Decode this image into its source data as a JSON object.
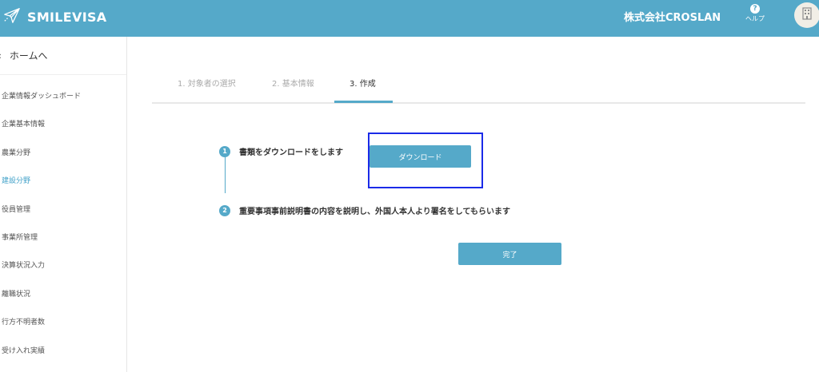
{
  "header": {
    "app_name": "SMILEVISA",
    "company_name": "株式会社CROSLAN",
    "help_label": "ヘルプ",
    "help_glyph": "?",
    "logo_icon": "paper-plane-icon",
    "avatar_icon": "building-icon",
    "bg_color": "#55a9c9"
  },
  "sidebar": {
    "home_label": "ホームへ",
    "home_chevron": "‹",
    "items": [
      {
        "label": "企業情報ダッシュボード"
      },
      {
        "label": "企業基本情報"
      },
      {
        "label": "農業分野"
      },
      {
        "label": "建設分野"
      },
      {
        "label": "役員管理"
      },
      {
        "label": "事業所管理"
      },
      {
        "label": "決算状況入力"
      },
      {
        "label": "離職状況"
      },
      {
        "label": "行方不明者数"
      },
      {
        "label": "受け入れ実績"
      }
    ],
    "active_item": "建設分野",
    "active_color": "#3fa0c8"
  },
  "stepper": {
    "steps": [
      {
        "label": "1. 対象者の選択"
      },
      {
        "label": "2. 基本情報"
      },
      {
        "label": "3. 作成"
      }
    ],
    "current_step": 3
  },
  "main": {
    "step1": {
      "number": "1",
      "text": "書類をダウンロードをします",
      "button_label": "ダウンロード"
    },
    "step2": {
      "number": "2",
      "text": "重要事項事前説明書の内容を説明し、外国人本人より署名をしてもらいます"
    },
    "complete_button_label": "完了"
  }
}
